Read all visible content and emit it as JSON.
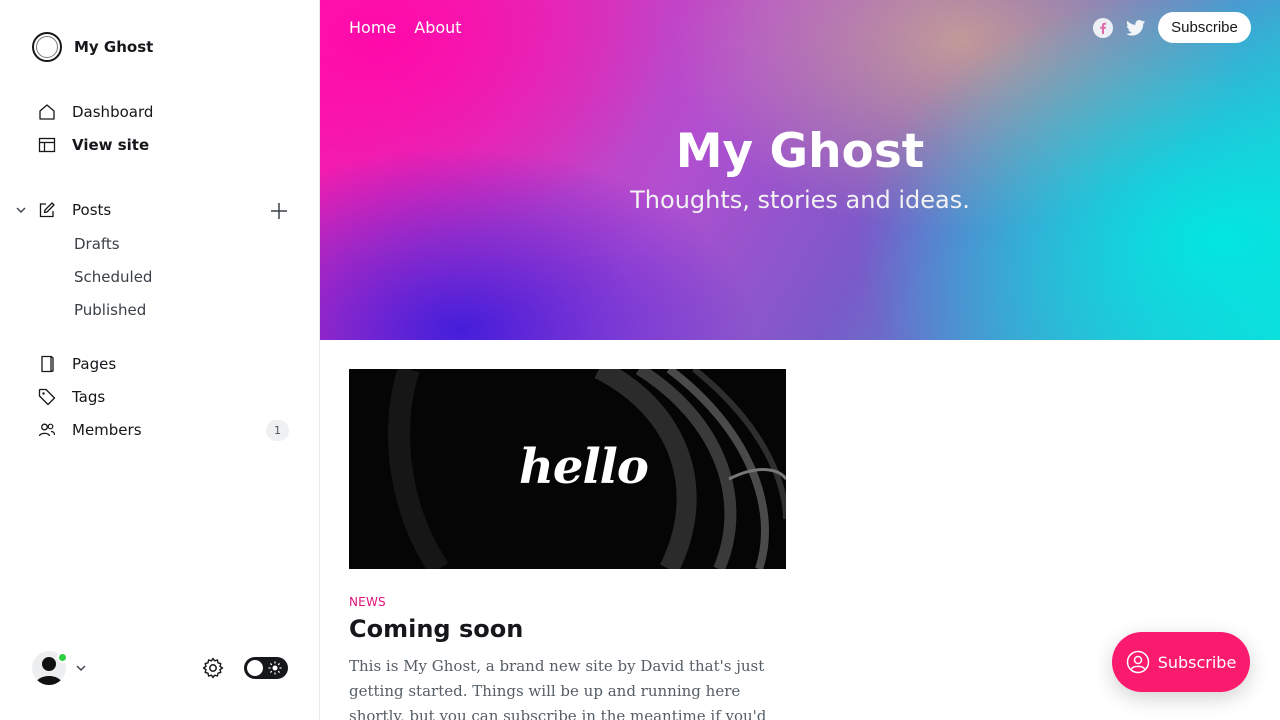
{
  "sidebar": {
    "brand": "My Ghost",
    "nav": {
      "dashboard": "Dashboard",
      "view_site": "View site",
      "posts": "Posts",
      "drafts": "Drafts",
      "scheduled": "Scheduled",
      "published": "Published",
      "pages": "Pages",
      "tags": "Tags",
      "members": "Members",
      "members_count": "1"
    }
  },
  "site": {
    "nav": [
      "Home",
      "About"
    ],
    "subscribe_label": "Subscribe",
    "title": "My Ghost",
    "description": "Thoughts, stories and ideas.",
    "post": {
      "image_text": "hello",
      "tag": "NEWS",
      "title": "Coming soon",
      "excerpt": "This is My Ghost, a brand new site by David that's just getting started. Things will be up and running here shortly, but you can subscribe in the meantime if you'd like to stay …"
    },
    "portal_button": "Subscribe"
  },
  "colors": {
    "accent": "#fa1a6e",
    "tag": "#e2137c",
    "online": "#30cf43"
  }
}
